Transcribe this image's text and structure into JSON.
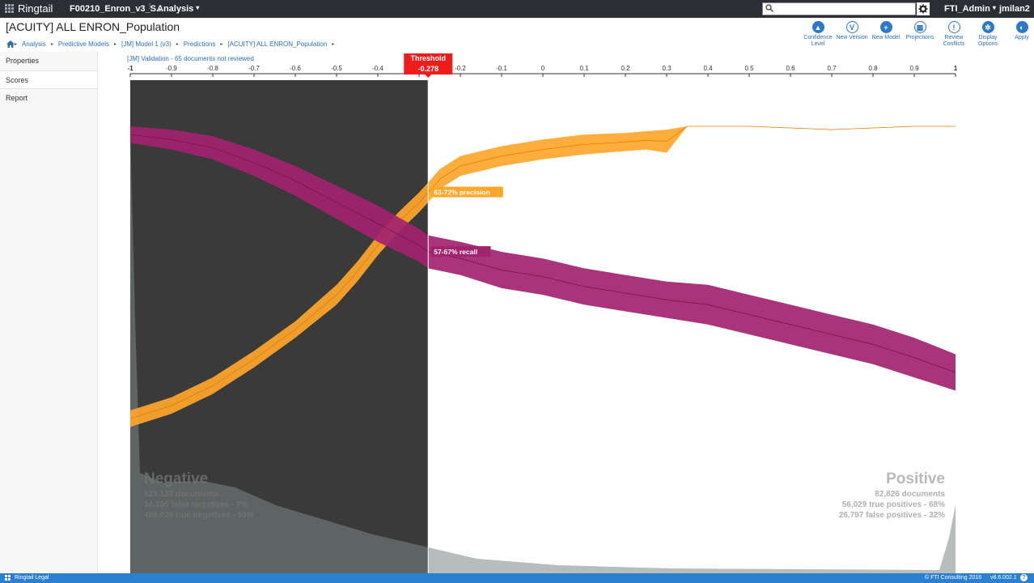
{
  "topbar": {
    "brand": "Ringtail",
    "case_name": "F00210_Enron_v3_S...",
    "module": "Analysis",
    "search_placeholder": "",
    "admin": "FTI_Admin",
    "user": "jmilan2"
  },
  "page": {
    "title": "[ACUITY] ALL ENRON_Population"
  },
  "breadcrumb": [
    "Analysis",
    "Predictive Models",
    "[JM] Model 1 (v3)",
    "Predictions",
    "[ACUITY] ALL ENRON_Population"
  ],
  "toolbar": [
    {
      "label": "Confidence Level",
      "icon": "confidence-icon"
    },
    {
      "label": "New Version",
      "icon": "version-icon"
    },
    {
      "label": "New Model",
      "icon": "plus-icon"
    },
    {
      "label": "Projections",
      "icon": "projections-icon"
    },
    {
      "label": "Review Conflicts",
      "icon": "alert-icon"
    },
    {
      "label": "Display Options",
      "icon": "gear-icon"
    },
    {
      "label": "Apply",
      "icon": "half-circle-icon"
    }
  ],
  "leftnav": [
    {
      "label": "Properties",
      "active": false
    },
    {
      "label": "Scores",
      "active": true
    },
    {
      "label": "Report",
      "active": false
    }
  ],
  "validation_note": "[JM] Validation - 65 documents not reviewed",
  "chart_data": {
    "type": "line",
    "x_ticks": [
      "-1",
      "-0.9",
      "-0.8",
      "-0.7",
      "-0.6",
      "-0.5",
      "-0.4",
      "-0.3",
      "-0.2",
      "-0.1",
      "0",
      "0.1",
      "0.2",
      "0.3",
      "0.4",
      "0.5",
      "0.6",
      "0.7",
      "0.8",
      "0.9",
      "1"
    ],
    "xlim": [
      -1,
      1
    ],
    "ylim": [
      0,
      1
    ],
    "threshold": {
      "title": "Threshold",
      "value": -0.278,
      "label": "-0.278"
    },
    "colors": {
      "precision": "#ffa62b",
      "recall": "#a3236f",
      "negative_area": "#3a3a3a",
      "dist": "#7b8585"
    },
    "series": [
      {
        "key": "precision",
        "label": "63-72% precision",
        "x": [
          -1,
          -0.9,
          -0.8,
          -0.7,
          -0.6,
          -0.5,
          -0.45,
          -0.4,
          -0.35,
          -0.3,
          -0.278,
          -0.25,
          -0.2,
          -0.1,
          0,
          0.1,
          0.2,
          0.25,
          0.3,
          0.35,
          0.4,
          0.5,
          0.6,
          0.7,
          0.8,
          0.9,
          1
        ],
        "low": [
          0.09,
          0.13,
          0.19,
          0.27,
          0.36,
          0.46,
          0.53,
          0.61,
          0.68,
          0.74,
          0.77,
          0.81,
          0.85,
          0.88,
          0.9,
          0.915,
          0.925,
          0.93,
          0.92,
          1.0,
          1.0,
          1.0,
          0.995,
          0.99,
          0.995,
          1.0,
          1.0
        ],
        "high": [
          0.14,
          0.18,
          0.24,
          0.32,
          0.41,
          0.52,
          0.59,
          0.67,
          0.74,
          0.8,
          0.83,
          0.87,
          0.91,
          0.94,
          0.96,
          0.975,
          0.98,
          0.985,
          0.99,
          1.0,
          1.0,
          1.0,
          0.995,
          0.99,
          0.995,
          1.0,
          1.0
        ]
      },
      {
        "key": "recall",
        "label": "57-67% recall",
        "x": [
          -1,
          -0.9,
          -0.8,
          -0.7,
          -0.6,
          -0.5,
          -0.4,
          -0.3,
          -0.278,
          -0.2,
          -0.1,
          0,
          0.1,
          0.2,
          0.3,
          0.4,
          0.5,
          0.6,
          0.7,
          0.8,
          0.9,
          1
        ],
        "low": [
          0.95,
          0.93,
          0.9,
          0.85,
          0.79,
          0.72,
          0.65,
          0.59,
          0.57,
          0.55,
          0.51,
          0.49,
          0.46,
          0.44,
          0.42,
          0.4,
          0.37,
          0.34,
          0.31,
          0.28,
          0.24,
          0.2
        ],
        "high": [
          1.0,
          0.99,
          0.97,
          0.93,
          0.88,
          0.82,
          0.76,
          0.69,
          0.67,
          0.65,
          0.62,
          0.6,
          0.57,
          0.55,
          0.53,
          0.52,
          0.49,
          0.46,
          0.43,
          0.4,
          0.36,
          0.31
        ]
      }
    ],
    "negative": {
      "title": "Negative",
      "documents": "523,125 documents",
      "false_negatives": "34,105  false negatives - 7%",
      "true_negatives": "489,020 true negatives - 93%"
    },
    "positive": {
      "title": "Positive",
      "documents": "82,826 documents",
      "true_positives": "56,029  true positives - 68%",
      "false_positives": "26,797 false positives - 32%"
    }
  },
  "statusbar": {
    "legal": "Ringtail Legal",
    "copyright": "© FTI Consulting 2016",
    "version": "v8.6.002.1"
  }
}
